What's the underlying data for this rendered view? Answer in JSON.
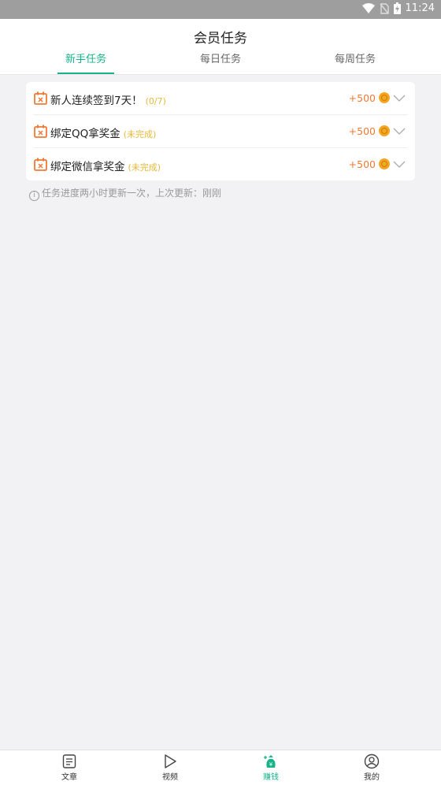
{
  "status_bar": {
    "time": "11:24"
  },
  "header": {
    "title": "会员任务"
  },
  "tabs": [
    {
      "label": "新手任务",
      "active": true
    },
    {
      "label": "每日任务",
      "active": false
    },
    {
      "label": "每周任务",
      "active": false
    }
  ],
  "tasks": [
    {
      "name": "新人连续签到7天！",
      "status": "(0/7)",
      "reward": "+500"
    },
    {
      "name": "绑定QQ拿奖金",
      "status": "(未完成)",
      "reward": "+500"
    },
    {
      "name": "绑定微信拿奖金",
      "status": "(未完成)",
      "reward": "+500"
    }
  ],
  "note": "任务进度两小时更新一次，上次更新：刚刚",
  "bottom_nav": [
    {
      "label": "文章",
      "icon": "article-icon",
      "active": false
    },
    {
      "label": "视频",
      "icon": "play-icon",
      "active": false
    },
    {
      "label": "赚钱",
      "icon": "money-bag-icon",
      "active": true
    },
    {
      "label": "我的",
      "icon": "user-icon",
      "active": false
    }
  ],
  "colors": {
    "accent": "#17b48a",
    "reward": "#f07a34",
    "status": "#e6b93c"
  }
}
